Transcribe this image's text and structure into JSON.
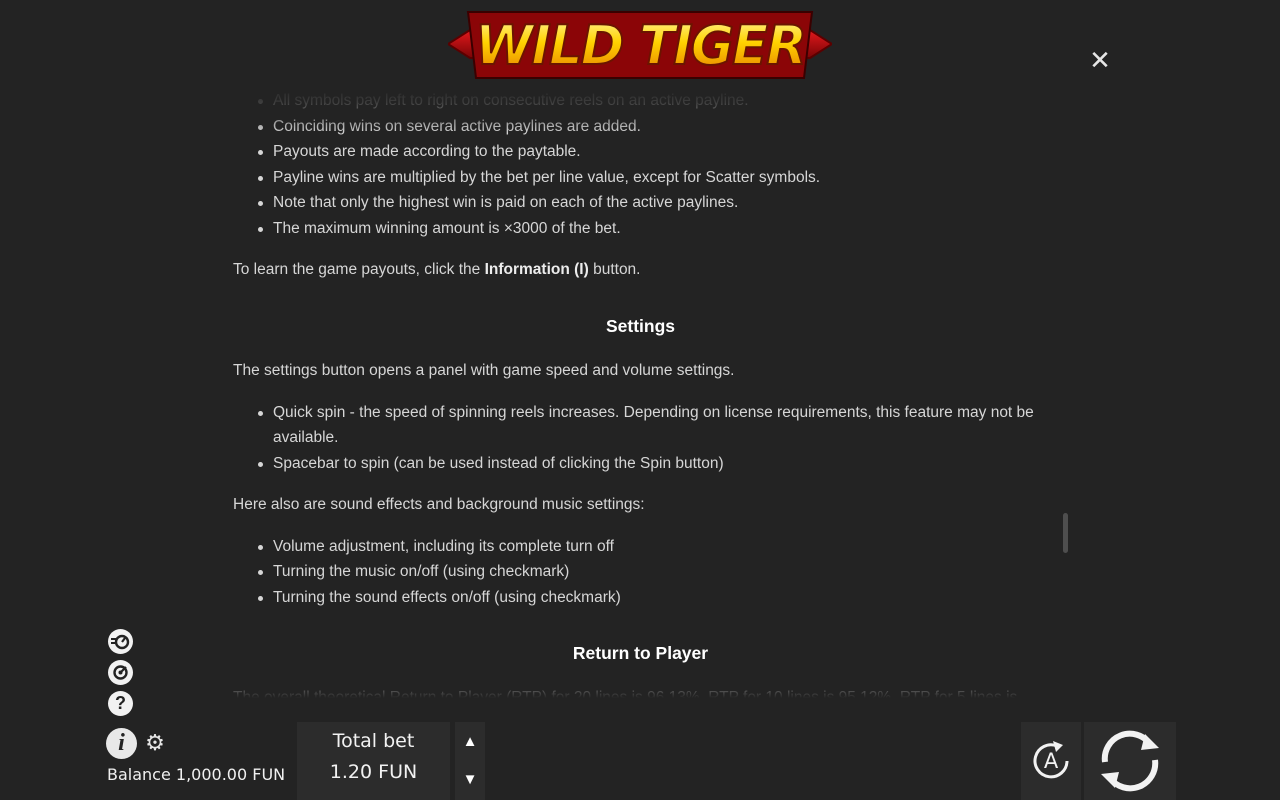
{
  "header": {
    "logo_text": "WILD TIGER",
    "close_icon": "close-icon"
  },
  "content": {
    "rules_list": [
      "All symbols pay left to right on consecutive reels on an active payline.",
      "Coinciding wins on several active paylines are added.",
      "Payouts are made according to the paytable.",
      "Payline wins are multiplied by the bet per line value, except for Scatter symbols.",
      "Note that only the highest win is paid on each of the active paylines.",
      "The maximum winning amount is ×3000 of the bet."
    ],
    "payouts_note": {
      "before": "To learn the game payouts, click the ",
      "strong": "Information (I)",
      "after": " button."
    },
    "settings_heading": "Settings",
    "settings_intro": "The settings button opens a panel with game speed and volume settings.",
    "settings_list": [
      "Quick spin - the speed of spinning reels increases. Depending on license requirements, this feature may not be available.",
      "Spacebar to spin (can be used instead of clicking the Spin button)"
    ],
    "sound_intro": "Here also are sound effects and background music settings:",
    "sound_list": [
      "Volume adjustment, including its complete turn off",
      "Turning the music on/off (using checkmark)",
      "Turning the sound effects on/off (using checkmark)"
    ],
    "rtp_heading": "Return to Player",
    "rtp_partial": "The overall theoretical Return to Player (RTP) for 20 lines is 96.13%, RTP for 10 lines is 95.12%, RTP for 5 lines is"
  },
  "side_controls": {
    "icons": [
      "turbo-icon",
      "autoplay-icon",
      "help-icon",
      "info-icon",
      "gear-icon"
    ],
    "help_glyph": "?",
    "info_glyph": "i"
  },
  "footer": {
    "balance": "Balance 1,000.00 FUN",
    "total_bet_label": "Total bet",
    "total_bet_value": "1.20 FUN",
    "auto_label": "A"
  },
  "colors": {
    "background": "#232323",
    "panel": "#2c2c2c",
    "text": "#d6d6d6",
    "logo_red": "#b3090d",
    "logo_gold": "#ffd200"
  }
}
